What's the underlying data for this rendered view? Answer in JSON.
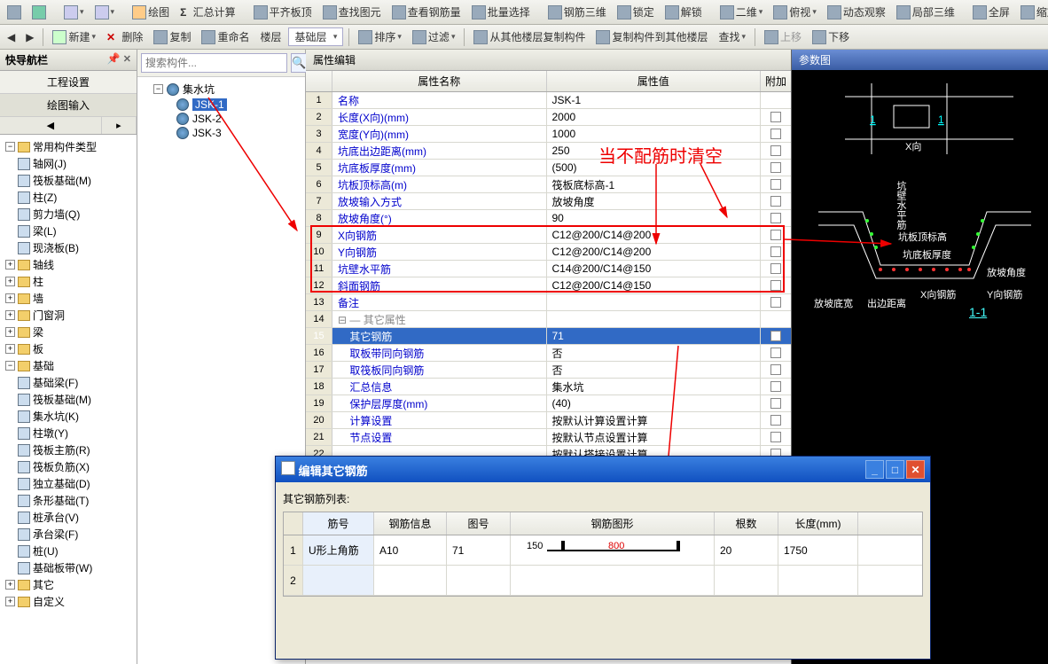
{
  "toolbar1": {
    "draw": "绘图",
    "sum": "汇总计算",
    "flat": "平齐板顶",
    "find": "查找图元",
    "rebar": "查看钢筋量",
    "batch": "批量选择",
    "rebar3d": "钢筋三维",
    "lock": "锁定",
    "unlock": "解锁",
    "view2d": "二维",
    "persp": "俯视",
    "orbit": "动态观察",
    "local3d": "局部三维",
    "full": "全屏",
    "zoom": "缩放"
  },
  "toolbar2": {
    "new": "新建",
    "del": "删除",
    "copy": "复制",
    "rename": "重命名",
    "floor": "楼层",
    "layer": "基础层",
    "sort": "排序",
    "filter": "过滤",
    "copyfrom": "从其他楼层复制构件",
    "copyto": "复制构件到其他楼层",
    "search": "查找",
    "up": "上移",
    "down": "下移"
  },
  "nav": {
    "title": "快导航栏",
    "btn1": "工程设置",
    "btn2": "绘图输入",
    "common": "常用构件类型",
    "items": [
      "轴网(J)",
      "筏板基础(M)",
      "柱(Z)",
      "剪力墙(Q)",
      "梁(L)",
      "现浇板(B)"
    ],
    "groups": [
      "轴线",
      "柱",
      "墙",
      "门窗洞",
      "梁",
      "板",
      "基础"
    ],
    "base_items": [
      "基础梁(F)",
      "筏板基础(M)",
      "集水坑(K)",
      "柱墩(Y)",
      "筏板主筋(R)",
      "筏板负筋(X)",
      "独立基础(D)",
      "条形基础(T)",
      "桩承台(V)",
      "承台梁(F)",
      "桩(U)",
      "基础板带(W)"
    ],
    "other": "其它",
    "custom": "自定义"
  },
  "search_placeholder": "搜索构件...",
  "tree2": {
    "root": "集水坑",
    "items": [
      "JSK-1",
      "JSK-2",
      "JSK-3"
    ]
  },
  "prop": {
    "title": "属性编辑",
    "col_name": "属性名称",
    "col_val": "属性值",
    "col_add": "附加",
    "rows": [
      {
        "n": "1",
        "name": "名称",
        "val": "JSK-1",
        "cb": false
      },
      {
        "n": "2",
        "name": "长度(X向)(mm)",
        "val": "2000",
        "cb": true
      },
      {
        "n": "3",
        "name": "宽度(Y向)(mm)",
        "val": "1000",
        "cb": true
      },
      {
        "n": "4",
        "name": "坑底出边距离(mm)",
        "val": "250",
        "cb": true
      },
      {
        "n": "5",
        "name": "坑底板厚度(mm)",
        "val": "(500)",
        "cb": true
      },
      {
        "n": "6",
        "name": "坑板顶标高(m)",
        "val": "筏板底标高-1",
        "cb": true
      },
      {
        "n": "7",
        "name": "放坡输入方式",
        "val": "放坡角度",
        "cb": true
      },
      {
        "n": "8",
        "name": "放坡角度(°)",
        "val": "90",
        "cb": true
      },
      {
        "n": "9",
        "name": "X向钢筋",
        "val": "C12@200/C14@200",
        "cb": true
      },
      {
        "n": "10",
        "name": "Y向钢筋",
        "val": "C12@200/C14@200",
        "cb": true
      },
      {
        "n": "11",
        "name": "坑壁水平筋",
        "val": "C14@200/C14@150",
        "cb": true
      },
      {
        "n": "12",
        "name": "斜面钢筋",
        "val": "C12@200/C14@150",
        "cb": true
      },
      {
        "n": "13",
        "name": "备注",
        "val": "",
        "cb": true
      },
      {
        "n": "14",
        "name": "其它属性",
        "val": "",
        "group": true
      },
      {
        "n": "15",
        "name": "其它钢筋",
        "val": "71",
        "sel": true,
        "cb": true
      },
      {
        "n": "16",
        "name": "取板带同向钢筋",
        "val": "否",
        "cb": true
      },
      {
        "n": "17",
        "name": "取筏板同向钢筋",
        "val": "否",
        "cb": true
      },
      {
        "n": "18",
        "name": "汇总信息",
        "val": "集水坑",
        "cb": true
      },
      {
        "n": "19",
        "name": "保护层厚度(mm)",
        "val": "(40)",
        "cb": true
      },
      {
        "n": "20",
        "name": "计算设置",
        "val": "按默认计算设置计算",
        "cb": true
      },
      {
        "n": "21",
        "name": "节点设置",
        "val": "按默认节点设置计算",
        "cb": true
      },
      {
        "n": "22",
        "name": "",
        "val": "按默认搭接设置计算",
        "cb": true
      }
    ]
  },
  "annotation": "当不配筋时清空",
  "diagram": {
    "title": "参数图",
    "labels": {
      "x": "X向",
      "one": "1",
      "top": "坑板顶标高",
      "thick": "坑底板厚度",
      "slope": "放坡角度",
      "xbar": "X向钢筋",
      "ybar": "Y向钢筋",
      "btmw": "放坡底宽",
      "edge": "出边距离",
      "sec": "1-1",
      "w2": "坑壁水平筋"
    }
  },
  "dialog": {
    "title": "编辑其它钢筋",
    "list_label": "其它钢筋列表:",
    "cols": {
      "jh": "筋号",
      "info": "钢筋信息",
      "th": "图号",
      "shape": "钢筋图形",
      "gs": "根数",
      "len": "长度(mm)"
    },
    "row": {
      "jh": "U形上角筋",
      "info": "A10",
      "th": "71",
      "n150": "150",
      "n800": "800",
      "gs": "20",
      "len": "1750"
    }
  }
}
